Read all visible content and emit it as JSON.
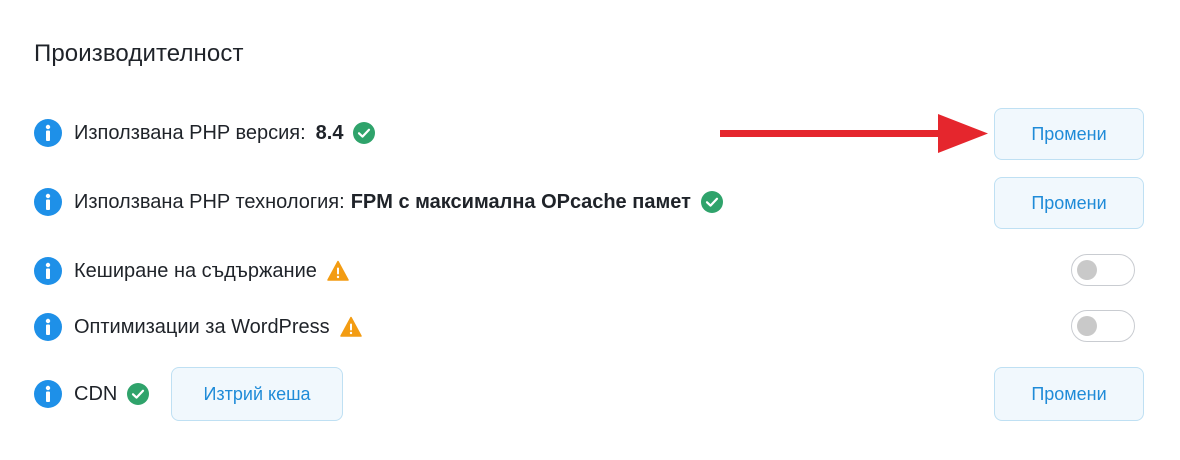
{
  "section": {
    "title": "Производителност"
  },
  "rows": {
    "php_version": {
      "label": "Използвана PHP версия:",
      "value": "8.4",
      "status": "check-icon",
      "button_label": "Промени"
    },
    "php_technology": {
      "label": "Използвана PHP технология:",
      "value": "FPM с максимална OPcache памет",
      "status": "check-icon",
      "button_label": "Промени"
    },
    "content_caching": {
      "label": "Кеширане на съдържание",
      "status": "warning-icon",
      "toggle_on": false
    },
    "wordpress_optimizations": {
      "label": "Оптимизации за WordPress",
      "status": "warning-icon",
      "toggle_on": false
    },
    "cdn": {
      "label": "CDN",
      "status": "check-icon",
      "purge_button_label": "Изтрий кеша",
      "button_label": "Промени"
    }
  },
  "colors": {
    "info": "#1e90e8",
    "success": "#2fa36b",
    "warning": "#f39c12",
    "accent_text": "#1f8bd8",
    "button_bg": "#f1f8fd",
    "annotation_arrow": "#e5262d"
  }
}
